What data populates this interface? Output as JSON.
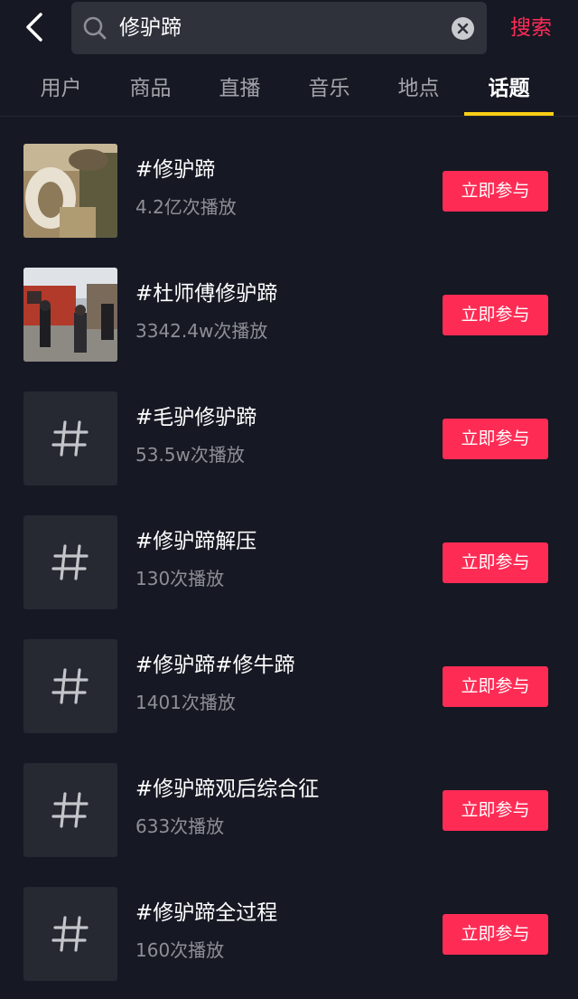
{
  "search": {
    "back_icon": "chevron-left-icon",
    "search_icon": "search-icon",
    "query": "修驴蹄",
    "clear_icon": "clear-icon",
    "action_label": "搜索"
  },
  "tabs": [
    {
      "label": "用户",
      "active": false
    },
    {
      "label": "商品",
      "active": false
    },
    {
      "label": "直播",
      "active": false
    },
    {
      "label": "音乐",
      "active": false
    },
    {
      "label": "地点",
      "active": false
    },
    {
      "label": "话题",
      "active": true
    }
  ],
  "colors": {
    "background": "#161823",
    "accent": "#fe2c55",
    "tab_indicator": "#face15"
  },
  "topics": [
    {
      "title": "#修驴蹄",
      "plays": "4.2亿次播放",
      "thumb": "photo-hoof",
      "join_label": "立即参与"
    },
    {
      "title": "#杜师傅修驴蹄",
      "plays": "3342.4w次播放",
      "thumb": "photo-street",
      "join_label": "立即参与"
    },
    {
      "title": "#毛驴修驴蹄",
      "plays": "53.5w次播放",
      "thumb": "hashtag-icon",
      "join_label": "立即参与"
    },
    {
      "title": "#修驴蹄解压",
      "plays": "130次播放",
      "thumb": "hashtag-icon",
      "join_label": "立即参与"
    },
    {
      "title": "#修驴蹄#修牛蹄",
      "plays": "1401次播放",
      "thumb": "hashtag-icon",
      "join_label": "立即参与"
    },
    {
      "title": "#修驴蹄观后综合征",
      "plays": "633次播放",
      "thumb": "hashtag-icon",
      "join_label": "立即参与"
    },
    {
      "title": "#修驴蹄全过程",
      "plays": "160次播放",
      "thumb": "hashtag-icon",
      "join_label": "立即参与"
    }
  ]
}
